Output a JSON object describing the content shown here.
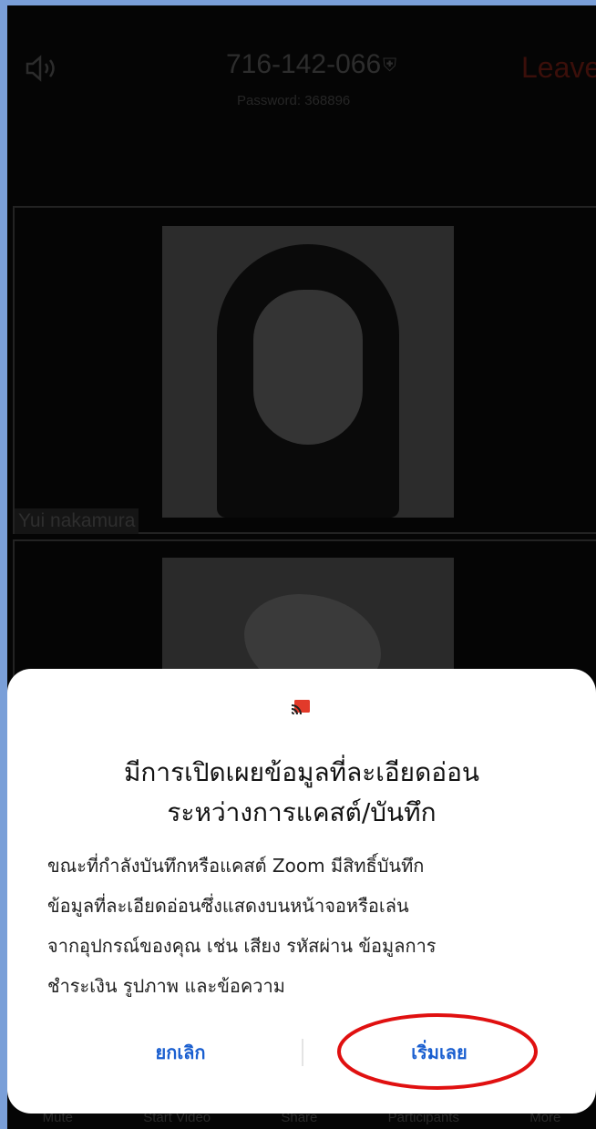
{
  "meeting": {
    "id": "716-142-066",
    "password": "Password: 368896",
    "leave_label": "Leave",
    "shield_glyph": "⛨"
  },
  "participants": [
    {
      "name": "Yui nakamura"
    }
  ],
  "toolbar": {
    "items": [
      "Mute",
      "Start Video",
      "Share",
      "Participants",
      "More"
    ]
  },
  "dialog": {
    "icon": "cast-icon",
    "title_line1": "มีการเปิดเผยข้อมูลที่ละเอียดอ่อน",
    "title_line2": "ระหว่างการแคสต์/บันทึก",
    "body_lines": [
      "ขณะที่กำลังบันทึกหรือแคสต์ Zoom มีสิทธิ์บันทึก",
      "ข้อมูลที่ละเอียดอ่อนซึ่งแสดงบนหน้าจอหรือเล่น",
      "จากอุปกรณ์ของคุณ เช่น เสียง รหัสผ่าน ข้อมูลการ",
      "ชำระเงิน รูปภาพ และข้อความ"
    ],
    "cancel_label": "ยกเลิก",
    "start_label": "เริ่มเลย"
  },
  "colors": {
    "frame": "#7a9fd8",
    "button_text": "#1a5fd0",
    "highlight_ring": "#e01010",
    "leave_text": "#3b0f0a"
  }
}
